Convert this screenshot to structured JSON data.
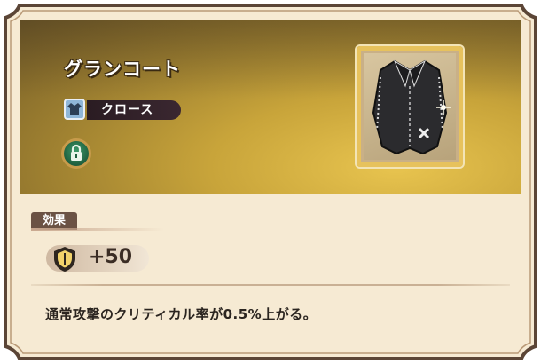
{
  "item": {
    "name": "グランコート",
    "category_label": "クロース",
    "category_icon": "clothing-icon",
    "lock_icon": "lock-icon"
  },
  "effect": {
    "section_label": "効果",
    "stat_icon": "defense-shield-icon",
    "stat_value": "+50",
    "description": "通常攻撃のクリティカル率が0.5%上がる。"
  },
  "colors": {
    "header_gold": "#c8a43a",
    "panel_cream": "#f6ead3",
    "frame_brown": "#5b4536",
    "tab_brown": "#6b5244"
  }
}
